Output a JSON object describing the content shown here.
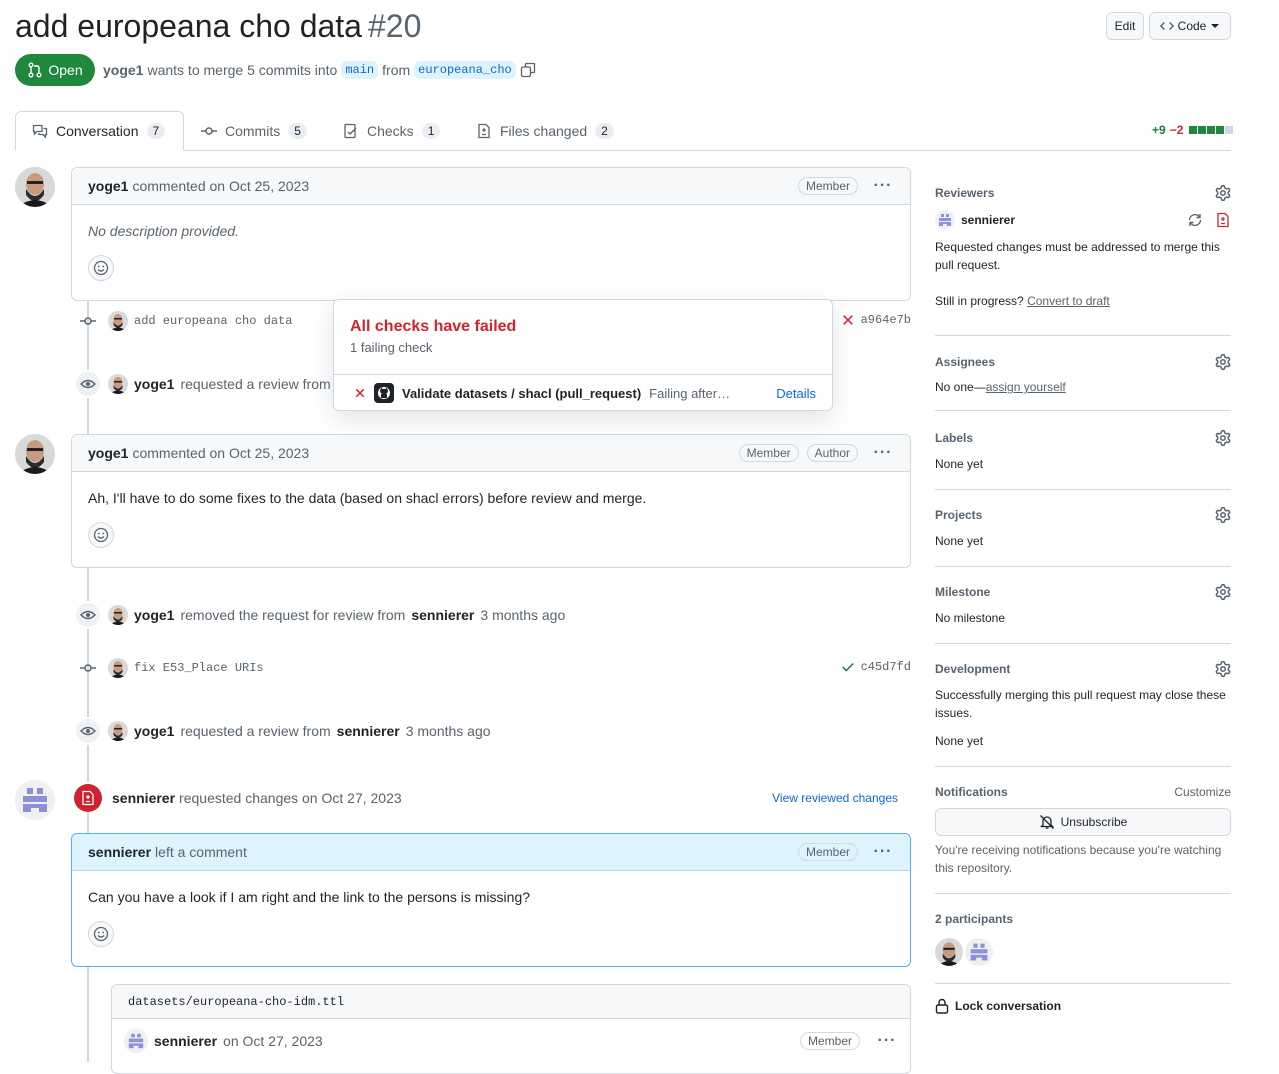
{
  "header": {
    "title": "add europeana cho data",
    "number": "#20",
    "edit_label": "Edit",
    "code_label": "Code",
    "state": "Open",
    "author": "yoge1",
    "merge_text": "wants to merge 5 commits into",
    "base_branch": "main",
    "from_text": "from",
    "head_branch": "europeana_cho"
  },
  "tabs": [
    {
      "label": "Conversation",
      "count": "7"
    },
    {
      "label": "Commits",
      "count": "5"
    },
    {
      "label": "Checks",
      "count": "1"
    },
    {
      "label": "Files changed",
      "count": "2"
    }
  ],
  "diffstat": {
    "additions": "+9",
    "deletions": "−2"
  },
  "timeline": {
    "c1": {
      "author": "yoge1",
      "action": "commented on Oct 25, 2023",
      "role": "Member",
      "body": "No description provided."
    },
    "commit1": {
      "message": "add europeana cho data",
      "sha": "a964e7b"
    },
    "review_request1": {
      "author": "yoge1",
      "text": "requested a review from"
    },
    "c2": {
      "author": "yoge1",
      "action": "commented on Oct 25, 2023",
      "role1": "Member",
      "role2": "Author",
      "body": "Ah, I'll have to do some fixes to the data (based on shacl errors) before review and merge."
    },
    "removed": {
      "author": "yoge1",
      "text": "removed the request for review from",
      "target": "sennierer",
      "time": "3 months ago"
    },
    "commit2": {
      "message": "fix E53_Place URIs",
      "sha": "c45d7fd"
    },
    "review_request2": {
      "author": "yoge1",
      "text": "requested a review from",
      "target": "sennierer",
      "time": "3 months ago"
    },
    "review": {
      "author": "sennierer",
      "text": "requested changes on Oct 27, 2023",
      "link": "View reviewed changes"
    },
    "c3": {
      "author": "sennierer",
      "action": "left a comment",
      "role": "Member",
      "body": "Can you have a look if I am right and the link to the persons is missing?"
    },
    "file": {
      "name": "datasets/europeana-cho-idm.ttl",
      "author": "sennierer",
      "action": "on Oct 27, 2023",
      "role": "Member"
    }
  },
  "popover": {
    "title": "All checks have failed",
    "subtitle": "1 failing check",
    "check_name": "Validate datasets / shacl (pull_request)",
    "check_status": "Failing after…",
    "details": "Details"
  },
  "sidebar": {
    "reviewers": {
      "title": "Reviewers",
      "name": "sennierer",
      "note": "Requested changes must be addressed to merge this pull request.",
      "progress_text": "Still in progress?",
      "draft_link": "Convert to draft"
    },
    "assignees": {
      "title": "Assignees",
      "none": "No one—",
      "link": "assign yourself"
    },
    "labels": {
      "title": "Labels",
      "value": "None yet"
    },
    "projects": {
      "title": "Projects",
      "value": "None yet"
    },
    "milestone": {
      "title": "Milestone",
      "value": "No milestone"
    },
    "development": {
      "title": "Development",
      "note": "Successfully merging this pull request may close these issues.",
      "value": "None yet"
    },
    "notifications": {
      "title": "Notifications",
      "customize": "Customize",
      "button": "Unsubscribe",
      "note": "You're receiving notifications because you're watching this repository."
    },
    "participants": {
      "title": "2 participants"
    },
    "lock": "Lock conversation"
  },
  "colors": {
    "open": "#1f883d",
    "fail": "#d1242f",
    "link": "#0969da",
    "add": "#1a7f37"
  }
}
